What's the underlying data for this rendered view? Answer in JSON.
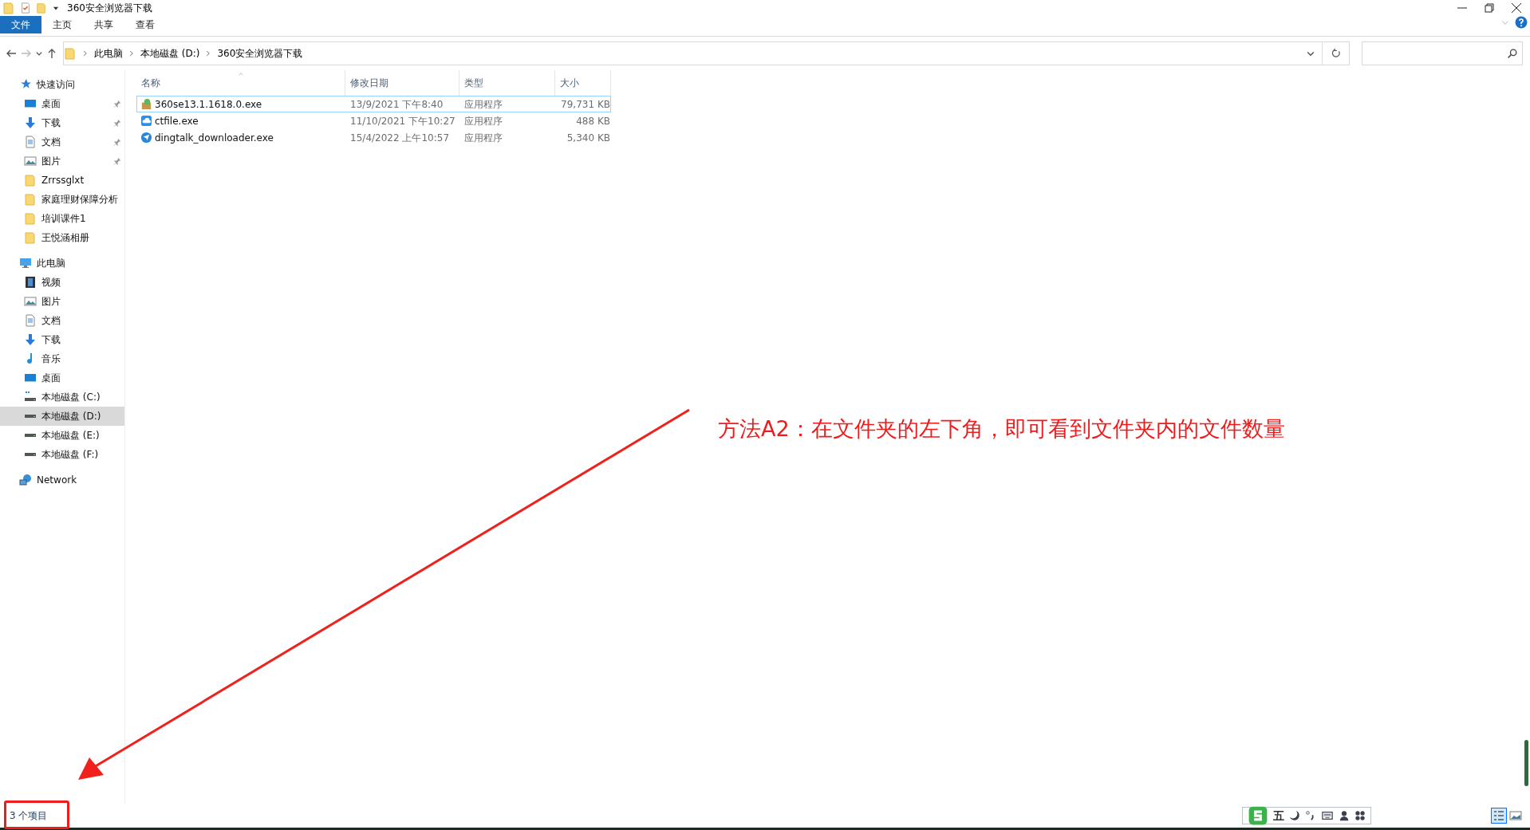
{
  "window": {
    "title": "360安全浏览器下载"
  },
  "ribbon_tabs": [
    {
      "label": "文件",
      "selected": true
    },
    {
      "label": "主页",
      "selected": false
    },
    {
      "label": "共享",
      "selected": false
    },
    {
      "label": "查看",
      "selected": false
    }
  ],
  "address": {
    "segments": [
      "此电脑",
      "本地磁盘 (D:)",
      "360安全浏览器下载"
    ]
  },
  "sidebar": {
    "items": [
      {
        "label": "快速访问",
        "kind": "star",
        "selected": false,
        "children": [
          {
            "label": "桌面",
            "kind": "desktop",
            "pinned": true,
            "selected": false
          },
          {
            "label": "下载",
            "kind": "download",
            "pinned": true,
            "selected": false
          },
          {
            "label": "文档",
            "kind": "document",
            "pinned": true,
            "selected": false
          },
          {
            "label": "图片",
            "kind": "picture",
            "pinned": true,
            "selected": false
          },
          {
            "label": "Zrrssglxt",
            "kind": "folder",
            "pinned": false,
            "selected": false
          },
          {
            "label": "家庭理财保障分析",
            "kind": "folder",
            "pinned": false,
            "selected": false
          },
          {
            "label": "培训课件1",
            "kind": "folder",
            "pinned": false,
            "selected": false
          },
          {
            "label": "王悦涵相册",
            "kind": "folder",
            "pinned": false,
            "selected": false
          }
        ]
      },
      {
        "label": "此电脑",
        "kind": "pc",
        "selected": false,
        "children": [
          {
            "label": "视频",
            "kind": "video",
            "pinned": false,
            "selected": false
          },
          {
            "label": "图片",
            "kind": "picture",
            "pinned": false,
            "selected": false
          },
          {
            "label": "文档",
            "kind": "document",
            "pinned": false,
            "selected": false
          },
          {
            "label": "下载",
            "kind": "download",
            "pinned": false,
            "selected": false
          },
          {
            "label": "音乐",
            "kind": "music",
            "pinned": false,
            "selected": false
          },
          {
            "label": "桌面",
            "kind": "desktop",
            "pinned": false,
            "selected": false
          },
          {
            "label": "本地磁盘 (C:)",
            "kind": "system-drive",
            "pinned": false,
            "selected": false
          },
          {
            "label": "本地磁盘 (D:)",
            "kind": "drive",
            "pinned": false,
            "selected": true
          },
          {
            "label": "本地磁盘 (E:)",
            "kind": "drive",
            "pinned": false,
            "selected": false
          },
          {
            "label": "本地磁盘 (F:)",
            "kind": "drive",
            "pinned": false,
            "selected": false
          }
        ]
      },
      {
        "label": "Network",
        "kind": "network",
        "selected": false
      }
    ]
  },
  "columns": [
    {
      "label": "名称",
      "sorted": true
    },
    {
      "label": "修改日期",
      "sorted": false
    },
    {
      "label": "类型",
      "sorted": false
    },
    {
      "label": "大小",
      "sorted": false
    }
  ],
  "rows": [
    {
      "name": "360se13.1.1618.0.exe",
      "kind": "installer",
      "date": "13/9/2021 下午8:40",
      "type": "应用程序",
      "size": "79,731 KB",
      "focused": true
    },
    {
      "name": "ctfile.exe",
      "kind": "cloud",
      "date": "11/10/2021 下午10:27",
      "type": "应用程序",
      "size": "488 KB",
      "focused": false
    },
    {
      "name": "dingtalk_downloader.exe",
      "kind": "plane",
      "date": "15/4/2022 上午10:57",
      "type": "应用程序",
      "size": "5,340 KB",
      "focused": false
    }
  ],
  "status_bar": {
    "item_count": "3 个项目"
  },
  "annotation": {
    "text": "方法A2：在文件夹的左下角，即可看到文件夹内的文件数量"
  },
  "ime_toolbar": {
    "mode": "五"
  }
}
